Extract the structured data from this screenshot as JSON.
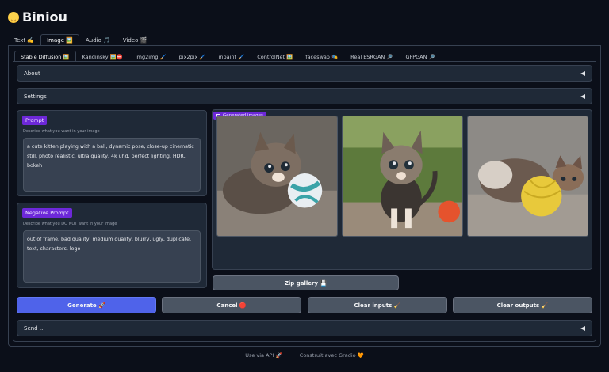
{
  "app": {
    "title": "Biniou"
  },
  "top_tabs": [
    {
      "label": "Text ✍️"
    },
    {
      "label": "Image 🖼️"
    },
    {
      "label": "Audio 🎵"
    },
    {
      "label": "Video 🎬"
    }
  ],
  "sub_tabs": [
    {
      "label": "Stable Diffusion 🖼️"
    },
    {
      "label": "Kandinsky 🖼️⛔"
    },
    {
      "label": "img2img 🖌️"
    },
    {
      "label": "pix2pix 🖌️"
    },
    {
      "label": "inpaint 🖌️"
    },
    {
      "label": "ControlNet 🖼️"
    },
    {
      "label": "faceswap 🎭"
    },
    {
      "label": "Real ESRGAN 🔎"
    },
    {
      "label": "GFPGAN 🔎"
    }
  ],
  "accordions": {
    "about": "About",
    "settings": "Settings",
    "send": "Send ..."
  },
  "prompt": {
    "label": "Prompt",
    "hint": "Describe what you want in your image",
    "value": "a cute kitten playing with a ball, dynamic pose, close-up cinematic still, photo realistic, ultra quality, 4k uhd, perfect lighting, HDR, bokeh"
  },
  "negative_prompt": {
    "label": "Negative Prompt",
    "hint": "Describe what you DO NOT want in your image",
    "value": "out of frame, bad quality, medium quality, blurry, ugly, duplicate, text, characters, logo"
  },
  "gallery": {
    "label": "Generated images"
  },
  "buttons": {
    "zip": "Zip gallery 💾",
    "generate": "Generate 🚀",
    "cancel": "Cancel 🛑",
    "clear_inputs": "Clear inputs 🧹",
    "clear_outputs": "Clear outputs 🧹"
  },
  "footer": {
    "api": "Use via API 🚀",
    "sep": "·",
    "built": "Construit avec Gradio 🧡"
  },
  "colors": {
    "background": "#0b0f19",
    "panel": "#1f2937",
    "accent_label": "#6d28d9",
    "primary_button": "#4f63ea"
  }
}
